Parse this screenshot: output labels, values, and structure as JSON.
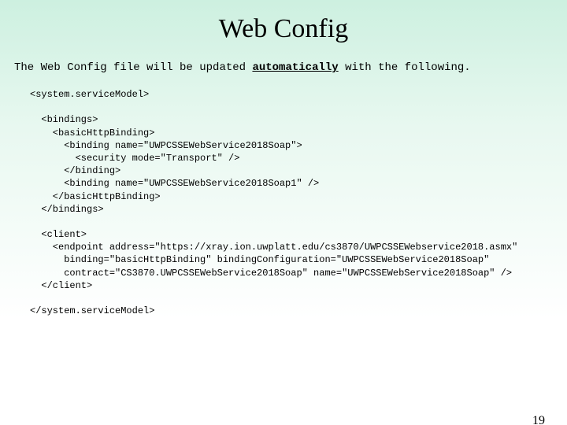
{
  "title": "Web Config",
  "intro_pre": "The Web Config file will be updated ",
  "intro_emph": "automatically",
  "intro_post": " with the following.",
  "code": "<system.serviceModel>\n\n  <bindings>\n    <basicHttpBinding>\n      <binding name=\"UWPCSSEWebService2018Soap\">\n        <security mode=\"Transport\" />\n      </binding>\n      <binding name=\"UWPCSSEWebService2018Soap1\" />\n    </basicHttpBinding>\n  </bindings>\n\n  <client>\n    <endpoint address=\"https://xray.ion.uwplatt.edu/cs3870/UWPCSSEWebservice2018.asmx\"\n      binding=\"basicHttpBinding\" bindingConfiguration=\"UWPCSSEWebService2018Soap\"\n      contract=\"CS3870.UWPCSSEWebService2018Soap\" name=\"UWPCSSEWebService2018Soap\" />\n  </client>\n\n</system.serviceModel>",
  "page_number": "19"
}
